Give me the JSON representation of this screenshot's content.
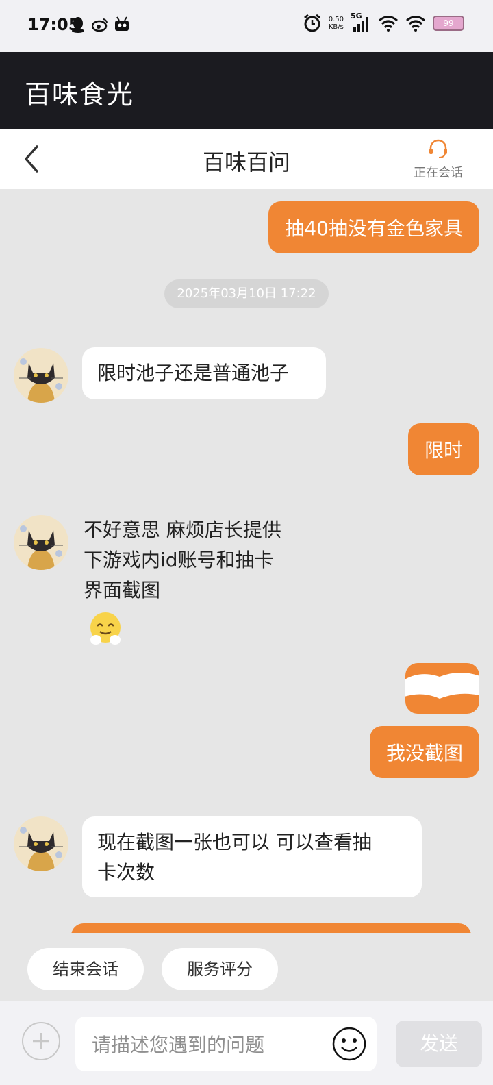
{
  "status_bar": {
    "time": "17:05",
    "net_speed_value": "0.50",
    "net_speed_unit": "KB/s",
    "network_type": "5G",
    "battery": "99",
    "left_icons": [
      "qq-icon",
      "weibo-icon",
      "app-icon"
    ],
    "right_icons": [
      "alarm-icon",
      "signal-icon",
      "wifi-icon",
      "wifi-icon",
      "battery-icon"
    ]
  },
  "app": {
    "title": "百味食光"
  },
  "nav": {
    "title": "百味百问",
    "session_status": "正在会话"
  },
  "messages": [
    {
      "side": "right",
      "text": "抽40抽没有金色家具"
    },
    {
      "side": "time",
      "text": "2025年03月10日 17:22"
    },
    {
      "side": "left",
      "text": "限时池子还是普通池子"
    },
    {
      "side": "right",
      "text": "限时"
    },
    {
      "side": "left",
      "lines": [
        "不好意思 麻烦店长提供",
        "下游戏内id账号和抽卡",
        "界面截图"
      ],
      "emoji": "hugging-face"
    },
    {
      "side": "right",
      "text": "",
      "redacted": true
    },
    {
      "side": "right",
      "text": "我没截图"
    },
    {
      "side": "left",
      "lines": [
        "现在截图一张也可以 可以查看抽",
        "卡次数"
      ]
    }
  ],
  "quick_actions": [
    "结束会话",
    "服务评分"
  ],
  "input": {
    "placeholder": "请描述您遇到的问题",
    "value": "",
    "send_label": "发送"
  },
  "colors": {
    "accent": "#f08634",
    "header_bg": "#1b1b20",
    "chat_bg": "#e6e6e6"
  }
}
